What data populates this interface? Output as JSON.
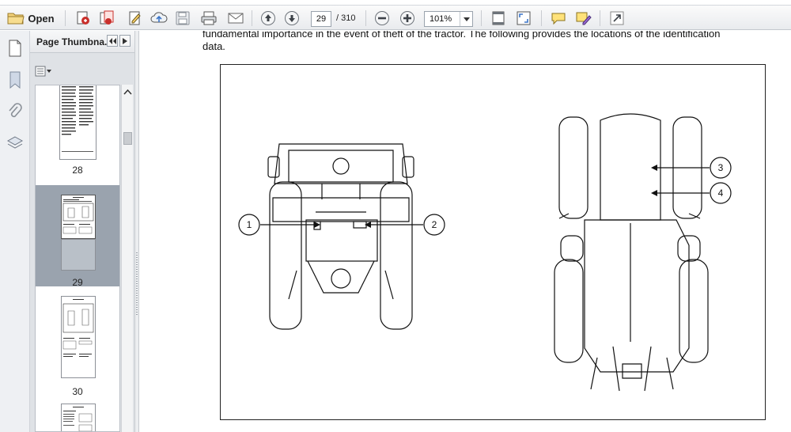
{
  "toolbar": {
    "open_label": "Open",
    "page_current": "29",
    "page_total": "/ 310",
    "zoom_value": "101%"
  },
  "panel": {
    "title": "Page Thumbna...",
    "thumbnails": [
      {
        "label": "28"
      },
      {
        "label": "29"
      },
      {
        "label": "30"
      }
    ]
  },
  "document": {
    "line1": "fundamental importance in the event of theft of the tractor. The following provides the locations of the identification",
    "line2": "data.",
    "callouts": [
      "1",
      "2",
      "3",
      "4"
    ]
  }
}
